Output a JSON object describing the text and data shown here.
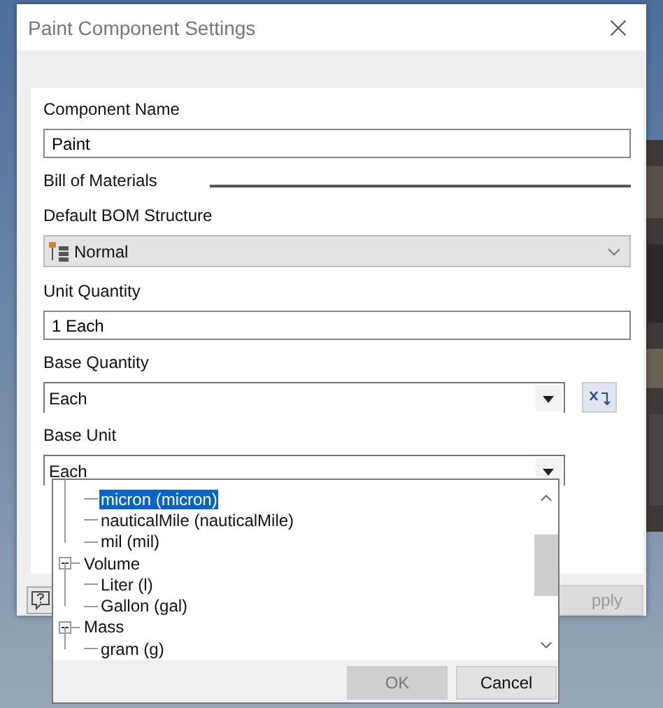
{
  "window": {
    "title": "Paint Component Settings"
  },
  "form": {
    "component_name": {
      "label": "Component Name",
      "value": "Paint"
    },
    "section": "Bill of Materials",
    "bom_structure": {
      "label": "Default BOM Structure",
      "value": "Normal",
      "disabled": true
    },
    "unit_quantity": {
      "label": "Unit Quantity",
      "value": "1 Each"
    },
    "base_quantity": {
      "label": "Base Quantity",
      "value": "Each"
    },
    "base_unit": {
      "label": "Base Unit",
      "value": "Each",
      "expanded": true
    }
  },
  "unit_tree": {
    "items": [
      {
        "children": [
          {
            "label": "micron (micron)",
            "selected": true
          },
          {
            "label": "nauticalMile (nauticalMile)",
            "selected": false
          },
          {
            "label": "mil (mil)",
            "selected": false
          }
        ]
      },
      {
        "label": "Volume",
        "expanded": true,
        "selected": false,
        "children": [
          {
            "label": "Liter (l)",
            "selected": false
          },
          {
            "label": "Gallon (gal)",
            "selected": false
          }
        ]
      },
      {
        "label": "Mass",
        "expanded": true,
        "selected": false,
        "children": [
          {
            "label": "gram (g)",
            "selected": false
          }
        ]
      }
    ]
  },
  "popup_buttons": [
    {
      "label": "OK",
      "disabled": true
    },
    {
      "label": "Cancel",
      "disabled": false
    }
  ],
  "footer": {
    "apply": "pply"
  }
}
